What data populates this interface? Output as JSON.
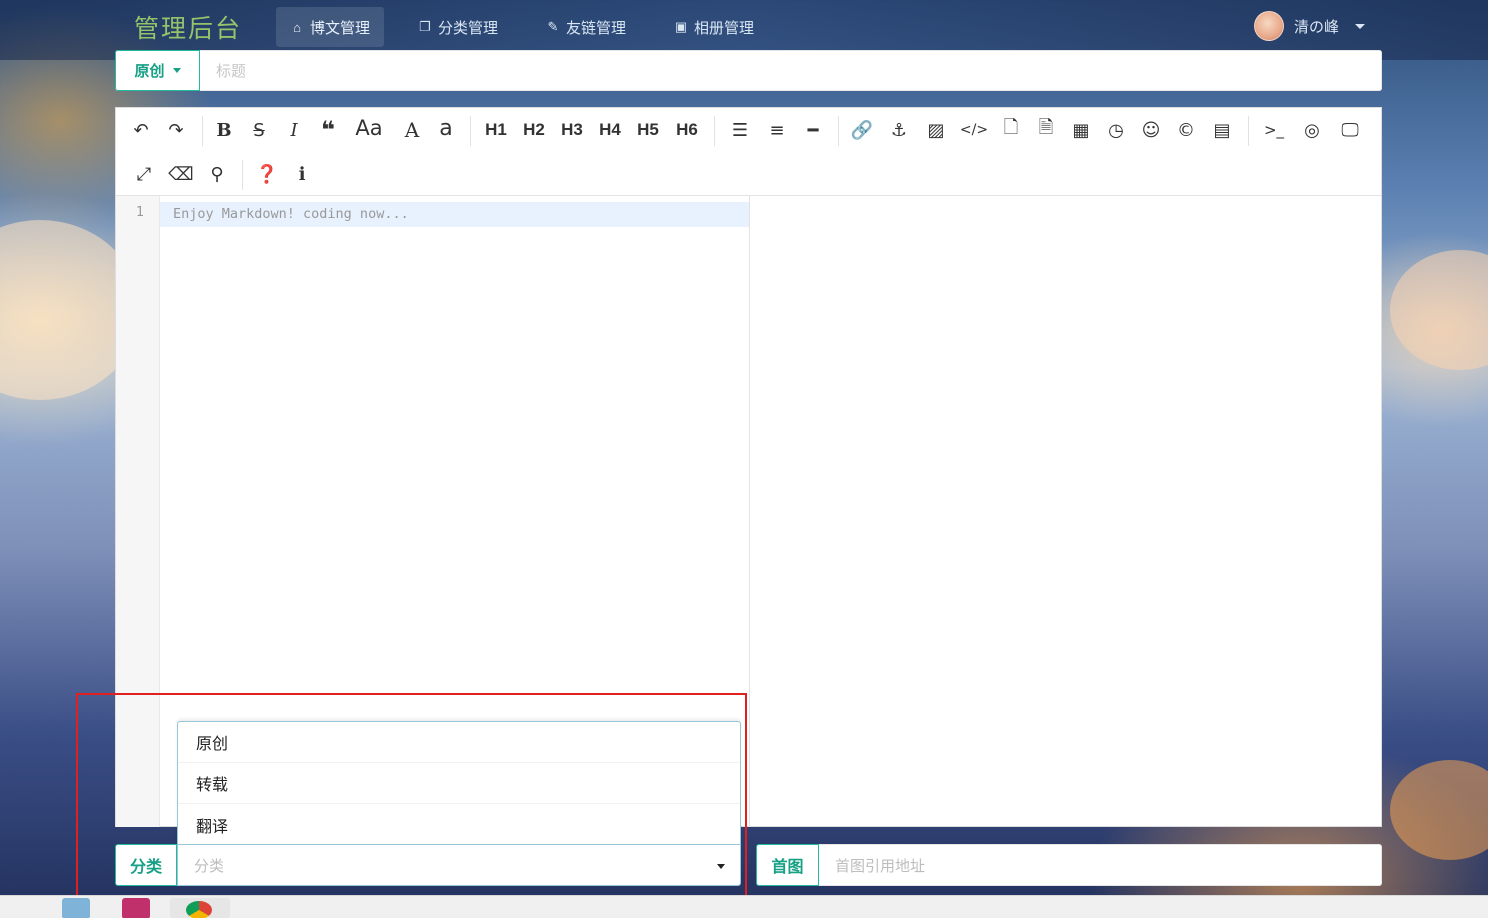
{
  "app": {
    "logo": "管理后台"
  },
  "nav": {
    "items": [
      {
        "label": "博文管理",
        "icon": "home-icon",
        "active": true
      },
      {
        "label": "分类管理",
        "icon": "copy-icon",
        "active": false
      },
      {
        "label": "友链管理",
        "icon": "pencil-icon",
        "active": false
      },
      {
        "label": "相册管理",
        "icon": "image-icon",
        "active": false
      }
    ],
    "user": {
      "name": "清の峰"
    }
  },
  "title_row": {
    "type_label": "原创",
    "title_placeholder": "标题"
  },
  "editor": {
    "line_number": "1",
    "placeholder": "Enjoy Markdown! coding now...",
    "toolbar": {
      "headings": [
        "H1",
        "H2",
        "H3",
        "H4",
        "H5",
        "H6"
      ],
      "text_buttons": {
        "case_upper_lower": "Aa",
        "upper": "A",
        "lower": "a"
      }
    }
  },
  "bottom": {
    "category_label": "分类",
    "category_placeholder": "分类",
    "dropdown_options": [
      "原创",
      "转载",
      "翻译"
    ],
    "first_image_label": "首图",
    "first_image_placeholder": "首图引用地址"
  },
  "colors": {
    "accent": "#16a085",
    "highlight_box": "#e02020"
  }
}
